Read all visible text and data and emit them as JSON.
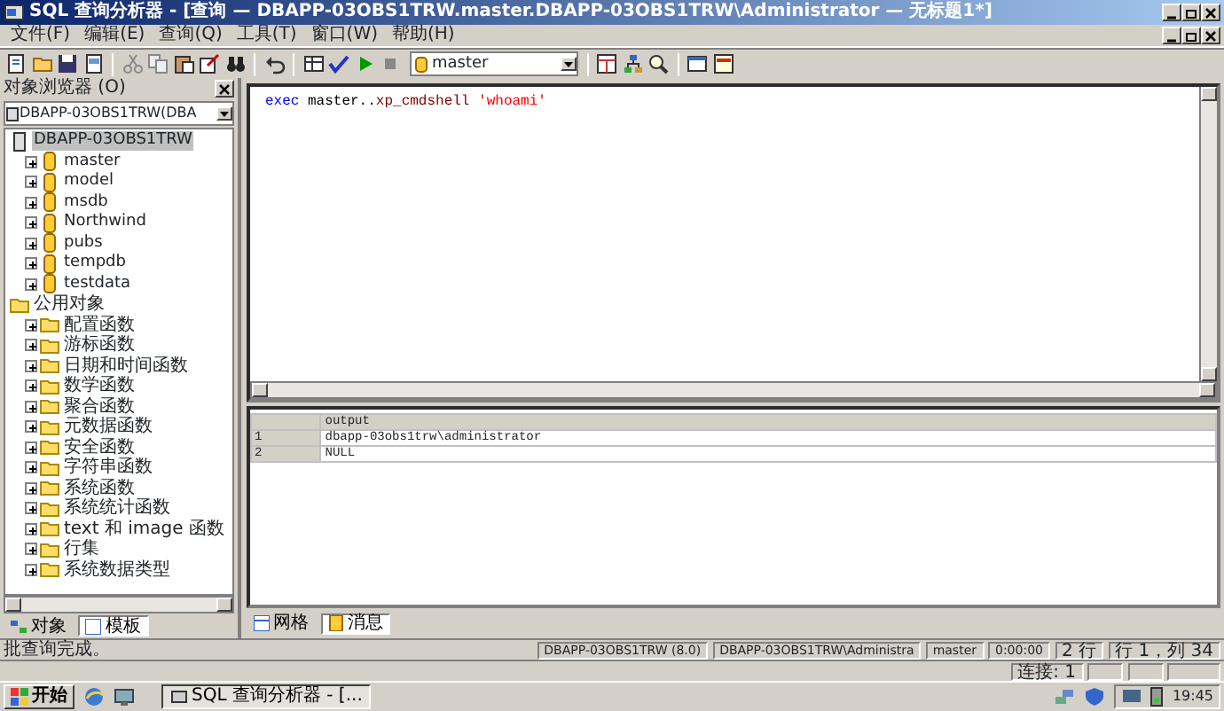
{
  "window": {
    "title": "SQL 查询分析器 - [查询 — DBAPP-03OBS1TRW.master.DBAPP-03OBS1TRW\\Administrator — 无标题1*]"
  },
  "menu": [
    "文件(F)",
    "编辑(E)",
    "查询(Q)",
    "工具(T)",
    "窗口(W)",
    "帮助(H)"
  ],
  "toolbar": {
    "database": "master"
  },
  "object_browser": {
    "title": "对象浏览器 (O)",
    "server_combo": "DBAPP-03OBS1TRW(DBA",
    "tree": [
      {
        "label": "DBAPP-03OBS1TRW",
        "kind": "server",
        "selected": true,
        "children": [
          {
            "label": "master",
            "kind": "database",
            "expanded": false,
            "selected": false
          },
          {
            "label": "model",
            "kind": "database",
            "expanded": false,
            "selected": false
          },
          {
            "label": "msdb",
            "kind": "database",
            "expanded": false,
            "selected": false
          },
          {
            "label": "Northwind",
            "kind": "database",
            "expanded": false,
            "selected": false
          },
          {
            "label": "pubs",
            "kind": "database",
            "expanded": false,
            "selected": false
          },
          {
            "label": "tempdb",
            "kind": "database",
            "expanded": false,
            "selected": false
          },
          {
            "label": "testdata",
            "kind": "database",
            "expanded": false,
            "selected": false
          }
        ]
      },
      {
        "label": "公用对象",
        "kind": "folder",
        "selected": false,
        "children": [
          {
            "label": "配置函数",
            "kind": "folder",
            "expanded": false,
            "selected": false
          },
          {
            "label": "游标函数",
            "kind": "folder",
            "expanded": false,
            "selected": false
          },
          {
            "label": "日期和时间函数",
            "kind": "folder",
            "expanded": false,
            "selected": false
          },
          {
            "label": "数学函数",
            "kind": "folder",
            "expanded": false,
            "selected": false
          },
          {
            "label": "聚合函数",
            "kind": "folder",
            "expanded": false,
            "selected": false
          },
          {
            "label": "元数据函数",
            "kind": "folder",
            "expanded": false,
            "selected": false
          },
          {
            "label": "安全函数",
            "kind": "folder",
            "expanded": false,
            "selected": false
          },
          {
            "label": "字符串函数",
            "kind": "folder",
            "expanded": false,
            "selected": false
          },
          {
            "label": "系统函数",
            "kind": "folder",
            "expanded": false,
            "selected": false
          },
          {
            "label": "系统统计函数",
            "kind": "folder",
            "expanded": false,
            "selected": false
          },
          {
            "label": "text 和 image 函数",
            "kind": "folder",
            "expanded": false,
            "selected": false
          },
          {
            "label": "行集",
            "kind": "folder",
            "expanded": false,
            "selected": false
          },
          {
            "label": "系统数据类型",
            "kind": "folder",
            "expanded": false,
            "selected": false
          }
        ]
      }
    ],
    "tabs": [
      {
        "label": "对象",
        "selected": false
      },
      {
        "label": "模板",
        "selected": true
      }
    ]
  },
  "editor": {
    "tokens": [
      {
        "text": "exec",
        "kind": "keyword"
      },
      {
        "text": " master..",
        "kind": "plain"
      },
      {
        "text": "xp_cmdshell",
        "kind": "proc"
      },
      {
        "text": " 'whoami'",
        "kind": "string"
      }
    ]
  },
  "results": {
    "columns": [
      "",
      "output"
    ],
    "rows": [
      [
        "1",
        "dbapp-03obs1trw\\administrator"
      ],
      [
        "2",
        "NULL"
      ]
    ],
    "tabs": [
      {
        "label": "网格",
        "selected": false
      },
      {
        "label": "消息",
        "selected": true
      }
    ]
  },
  "status_bar": {
    "message": "批查询完成。",
    "fields": [
      "DBAPP-03OBS1TRW (8.0)",
      "DBAPP-03OBS1TRW\\Administra",
      "master",
      "0:00:00",
      "2 行",
      "行 1，列 34"
    ],
    "connections": "连接: 1"
  },
  "taskbar": {
    "start": "开始",
    "task": "SQL 查询分析器 - [...",
    "clock": "19:45"
  }
}
